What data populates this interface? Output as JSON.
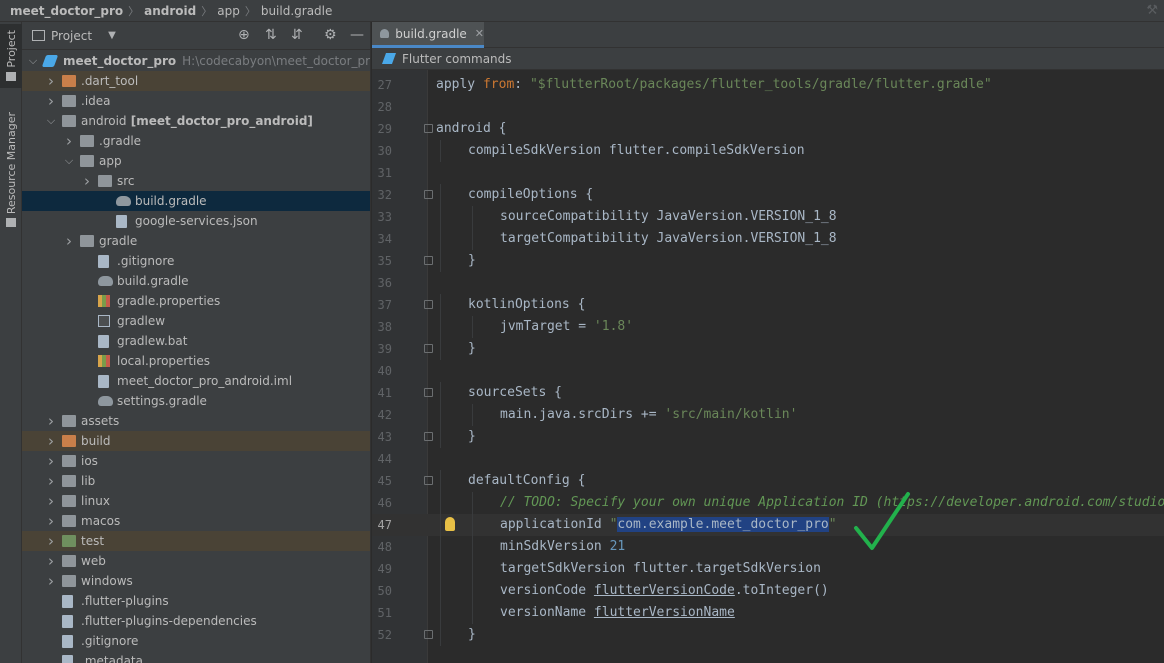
{
  "breadcrumb": [
    "meet_doctor_pro",
    "android",
    "app",
    "build.gradle"
  ],
  "sidebar": {
    "project_tab": "Project",
    "resource_manager_tab": "Resource Manager"
  },
  "project_panel": {
    "title": "Project",
    "tree": [
      {
        "label": "meet_doctor_pro",
        "path": "H:\\codecabyon\\meet_doctor_pro",
        "depth": 0,
        "arrow": "down",
        "icon": "flutter-icon",
        "bold": true
      },
      {
        "label": ".dart_tool",
        "depth": 1,
        "arrow": "right",
        "icon": "folder-orange-icon",
        "bg": "excl"
      },
      {
        "label": ".idea",
        "depth": 1,
        "arrow": "right",
        "icon": "folder-icon"
      },
      {
        "label": "android",
        "extra": "[meet_doctor_pro_android]",
        "depth": 1,
        "arrow": "down",
        "icon": "folder-icon"
      },
      {
        "label": ".gradle",
        "depth": 2,
        "arrow": "right",
        "icon": "folder-icon"
      },
      {
        "label": "app",
        "depth": 2,
        "arrow": "down",
        "icon": "folder-icon"
      },
      {
        "label": "src",
        "depth": 3,
        "arrow": "right",
        "icon": "folder-icon"
      },
      {
        "label": "build.gradle",
        "depth": 4,
        "arrow": "",
        "icon": "gradle-icon",
        "bg": "sel"
      },
      {
        "label": "google-services.json",
        "depth": 4,
        "arrow": "",
        "icon": "json-file-icon"
      },
      {
        "label": "gradle",
        "depth": 2,
        "arrow": "right",
        "icon": "folder-icon"
      },
      {
        "label": ".gitignore",
        "depth": 3,
        "arrow": "",
        "icon": "file-icon"
      },
      {
        "label": "build.gradle",
        "depth": 3,
        "arrow": "",
        "icon": "gradle-icon"
      },
      {
        "label": "gradle.properties",
        "depth": 3,
        "arrow": "",
        "icon": "properties-icon"
      },
      {
        "label": "gradlew",
        "depth": 3,
        "arrow": "",
        "icon": "terminal-icon"
      },
      {
        "label": "gradlew.bat",
        "depth": 3,
        "arrow": "",
        "icon": "file-icon"
      },
      {
        "label": "local.properties",
        "depth": 3,
        "arrow": "",
        "icon": "properties-icon"
      },
      {
        "label": "meet_doctor_pro_android.iml",
        "depth": 3,
        "arrow": "",
        "icon": "file-icon"
      },
      {
        "label": "settings.gradle",
        "depth": 3,
        "arrow": "",
        "icon": "gradle-icon"
      },
      {
        "label": "assets",
        "depth": 1,
        "arrow": "right",
        "icon": "folder-icon"
      },
      {
        "label": "build",
        "depth": 1,
        "arrow": "right",
        "icon": "folder-orange-icon",
        "bg": "excl"
      },
      {
        "label": "ios",
        "depth": 1,
        "arrow": "right",
        "icon": "folder-icon"
      },
      {
        "label": "lib",
        "depth": 1,
        "arrow": "right",
        "icon": "folder-icon"
      },
      {
        "label": "linux",
        "depth": 1,
        "arrow": "right",
        "icon": "folder-icon"
      },
      {
        "label": "macos",
        "depth": 1,
        "arrow": "right",
        "icon": "folder-icon"
      },
      {
        "label": "test",
        "depth": 1,
        "arrow": "right",
        "icon": "folder-green-icon",
        "bg": "excl"
      },
      {
        "label": "web",
        "depth": 1,
        "arrow": "right",
        "icon": "folder-icon"
      },
      {
        "label": "windows",
        "depth": 1,
        "arrow": "right",
        "icon": "folder-icon"
      },
      {
        "label": ".flutter-plugins",
        "depth": 1,
        "arrow": "",
        "icon": "file-icon"
      },
      {
        "label": ".flutter-plugins-dependencies",
        "depth": 1,
        "arrow": "",
        "icon": "file-icon"
      },
      {
        "label": ".gitignore",
        "depth": 1,
        "arrow": "",
        "icon": "file-icon"
      },
      {
        "label": ".metadata",
        "depth": 1,
        "arrow": "",
        "icon": "file-icon"
      }
    ]
  },
  "editor": {
    "tab_label": "build.gradle",
    "notice": "Flutter commands",
    "current_line": 47,
    "lines": [
      {
        "n": 27,
        "indent": 0,
        "fold": false,
        "parts": [
          [
            "apply ",
            "p"
          ],
          [
            "from",
            "k"
          ],
          [
            ": ",
            "p"
          ],
          [
            "\"$flutterRoot",
            "s"
          ],
          [
            "/packages/flutter_tools/gradle/flutter.gradle\"",
            "s"
          ]
        ]
      },
      {
        "n": 28,
        "indent": 0,
        "fold": false,
        "parts": []
      },
      {
        "n": 29,
        "indent": 0,
        "fold": true,
        "parts": [
          [
            "android {",
            "p"
          ]
        ]
      },
      {
        "n": 30,
        "indent": 1,
        "fold": false,
        "parts": [
          [
            "compileSdkVersion flutter.compileSdkVersion",
            "p"
          ]
        ]
      },
      {
        "n": 31,
        "indent": 0,
        "fold": false,
        "parts": []
      },
      {
        "n": 32,
        "indent": 1,
        "fold": true,
        "parts": [
          [
            "compileOptions {",
            "p"
          ]
        ]
      },
      {
        "n": 33,
        "indent": 2,
        "fold": false,
        "parts": [
          [
            "sourceCompatibility JavaVersion.VERSION_1_8",
            "p"
          ]
        ]
      },
      {
        "n": 34,
        "indent": 2,
        "fold": false,
        "parts": [
          [
            "targetCompatibility JavaVersion.VERSION_1_8",
            "p"
          ]
        ]
      },
      {
        "n": 35,
        "indent": 1,
        "fold": true,
        "parts": [
          [
            "}",
            "p"
          ]
        ]
      },
      {
        "n": 36,
        "indent": 0,
        "fold": false,
        "parts": []
      },
      {
        "n": 37,
        "indent": 1,
        "fold": true,
        "parts": [
          [
            "kotlinOptions {",
            "p"
          ]
        ]
      },
      {
        "n": 38,
        "indent": 2,
        "fold": false,
        "parts": [
          [
            "jvmTarget = ",
            "p"
          ],
          [
            "'1.8'",
            "s"
          ]
        ]
      },
      {
        "n": 39,
        "indent": 1,
        "fold": true,
        "parts": [
          [
            "}",
            "p"
          ]
        ]
      },
      {
        "n": 40,
        "indent": 0,
        "fold": false,
        "parts": []
      },
      {
        "n": 41,
        "indent": 1,
        "fold": true,
        "parts": [
          [
            "sourceSets {",
            "p"
          ]
        ]
      },
      {
        "n": 42,
        "indent": 2,
        "fold": false,
        "parts": [
          [
            "main.java.srcDirs += ",
            "p"
          ],
          [
            "'src/main/kotlin'",
            "s"
          ]
        ]
      },
      {
        "n": 43,
        "indent": 1,
        "fold": true,
        "parts": [
          [
            "}",
            "p"
          ]
        ]
      },
      {
        "n": 44,
        "indent": 0,
        "fold": false,
        "parts": []
      },
      {
        "n": 45,
        "indent": 1,
        "fold": true,
        "parts": [
          [
            "defaultConfig {",
            "p"
          ]
        ]
      },
      {
        "n": 46,
        "indent": 2,
        "fold": false,
        "parts": [
          [
            "// TODO: Specify your own unique Application ID (",
            "c"
          ],
          [
            "https://developer.android.com/studio/build/application-id.html",
            "l"
          ]
        ]
      },
      {
        "n": 47,
        "indent": 2,
        "fold": false,
        "bulb": true,
        "parts": [
          [
            "applicationId ",
            "p"
          ],
          [
            "\"",
            "s"
          ],
          [
            "com.example.meet_doctor_pro",
            "h"
          ],
          [
            "\"",
            "s"
          ]
        ]
      },
      {
        "n": 48,
        "indent": 2,
        "fold": false,
        "parts": [
          [
            "minSdkVersion ",
            "p"
          ],
          [
            "21",
            "num"
          ]
        ]
      },
      {
        "n": 49,
        "indent": 2,
        "fold": false,
        "parts": [
          [
            "targetSdkVersion flutter.targetSdkVersion",
            "p"
          ]
        ]
      },
      {
        "n": 50,
        "indent": 2,
        "fold": false,
        "parts": [
          [
            "versionCode ",
            "p"
          ],
          [
            "flutterVersionCode",
            "u"
          ],
          [
            ".toInteger()",
            "p"
          ]
        ]
      },
      {
        "n": 51,
        "indent": 2,
        "fold": false,
        "parts": [
          [
            "versionName ",
            "p"
          ],
          [
            "flutterVersionName",
            "u"
          ]
        ]
      },
      {
        "n": 52,
        "indent": 1,
        "fold": true,
        "parts": [
          [
            "}",
            "p"
          ]
        ]
      }
    ]
  },
  "colors": {
    "keyword": "#cc7832",
    "string": "#6a8759",
    "comment": "#629755",
    "number": "#6897bb",
    "selection": "#214283",
    "checkmark": "#22b14c"
  }
}
